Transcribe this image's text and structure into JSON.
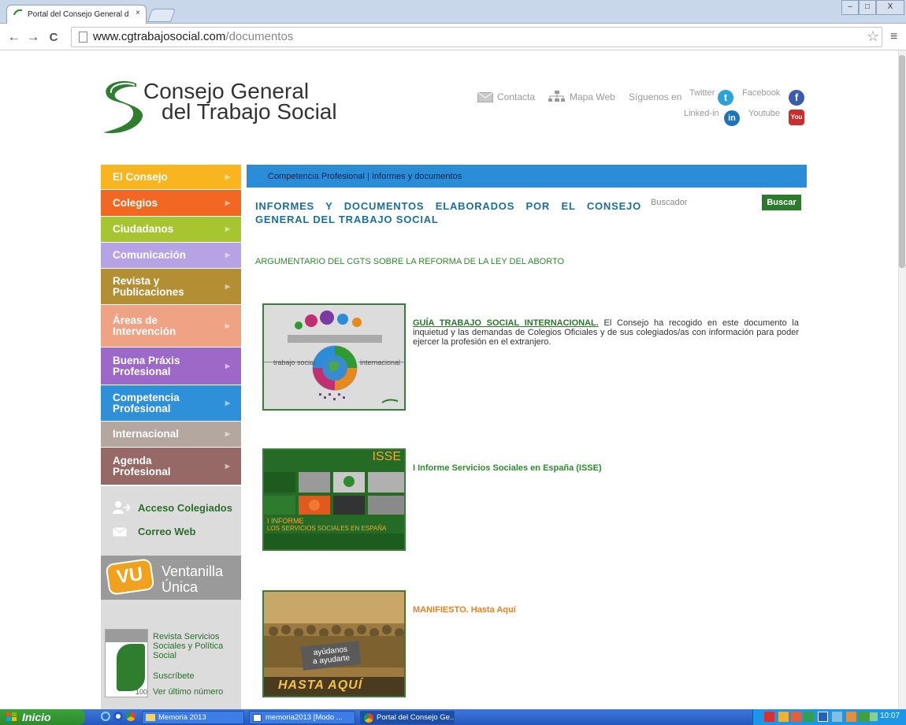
{
  "browser": {
    "tab_title": "Portal del Consejo General d",
    "tab_close": "×",
    "url_domain": "www.cgtrabajosocial.com",
    "url_path": "/documentos",
    "back": "←",
    "forward": "→",
    "reload": "C",
    "star": "☆",
    "menu": "≡",
    "win_min": "–",
    "win_max": "□",
    "win_close": "X"
  },
  "header": {
    "logo_line1": "Consejo General",
    "logo_line2": "del Trabajo Social",
    "contacta": "Contacta",
    "mapa_web": "Mapa Web",
    "siguenos": "Síguenos en",
    "twitter": "Twitter",
    "facebook": "Facebook",
    "linkedin": "Linked-in",
    "youtube": "Youtube"
  },
  "sidebar": {
    "items": [
      {
        "label": "El Consejo",
        "color": "#f9b520"
      },
      {
        "label": "Colegios",
        "color": "#f26722"
      },
      {
        "label": "Ciudadanos",
        "color": "#a6c531"
      },
      {
        "label": "Comunicación",
        "color": "#b6a3e6"
      },
      {
        "label": "Revista y\nPublicaciones",
        "color": "#b38e33"
      },
      {
        "label": "Áreas de\nIntervención",
        "color": "#f0a285"
      },
      {
        "label": "Buena Práxis\nProfesional",
        "color": "#9e68c8"
      },
      {
        "label": "Competencia\nProfesional",
        "color": "#2e90d8"
      },
      {
        "label": "Internacional",
        "color": "#b3a7a0"
      },
      {
        "label": "Agenda\nProfesional",
        "color": "#966966"
      }
    ],
    "acceso": "Acceso Colegiados",
    "correo": "Correo Web",
    "ventanilla_l1": "Ventanilla",
    "ventanilla_l2": "Única",
    "vu": "VU",
    "revista_l1": "Revista Servicios",
    "revista_l2": "Sociales y Política",
    "revista_l3": "Social",
    "suscribete": "Suscríbete",
    "ultimo": "Ver último número",
    "revista_num": "100"
  },
  "content": {
    "breadcrumb": "Competencia Profesional  |  Informes y documentos",
    "heading": "INFORMES Y DOCUMENTOS ELABORADOS POR EL CONSEJO GENERAL DEL TRABAJO SOCIAL",
    "search_label": "Buscador",
    "search_button": "Buscar",
    "argumentario": "ARGUMENTARIO DEL CGTS SOBRE LA REFORMA DE LA LEY DEL ABORTO",
    "doc1_title": "GUÍA TRABAJO SOCIAL INTERNACIONAL.",
    "doc1_text": " El Consejo ha recogido en este documento la inquietud y las demandas de Colegios Oficiales y de sus colegiados/as con información para poder ejercer la profesión en el extranjero.",
    "doc1_img_left": "trabajo social",
    "doc1_img_right": "internacional",
    "doc2_title": "I Informe Servicios Sociales en España (ISSE)",
    "doc2_img_tag": "ISSE",
    "doc2_img_l1": "I INFORME",
    "doc2_img_l2": "LOS SERVICIOS SOCIALES EN ESPAÑA",
    "doc3_title": "MANIFIESTO. Hasta Aquí",
    "doc3_img_sign": "ayúdanos\na ayudarte",
    "doc3_img_banner": "HASTA AQUÍ"
  },
  "taskbar": {
    "start": "Inicio",
    "btn1": "Memoria 2013",
    "btn2": "memoria2013 [Modo ...",
    "btn3": "Portal del Consejo Ge...",
    "clock": "10:07"
  }
}
